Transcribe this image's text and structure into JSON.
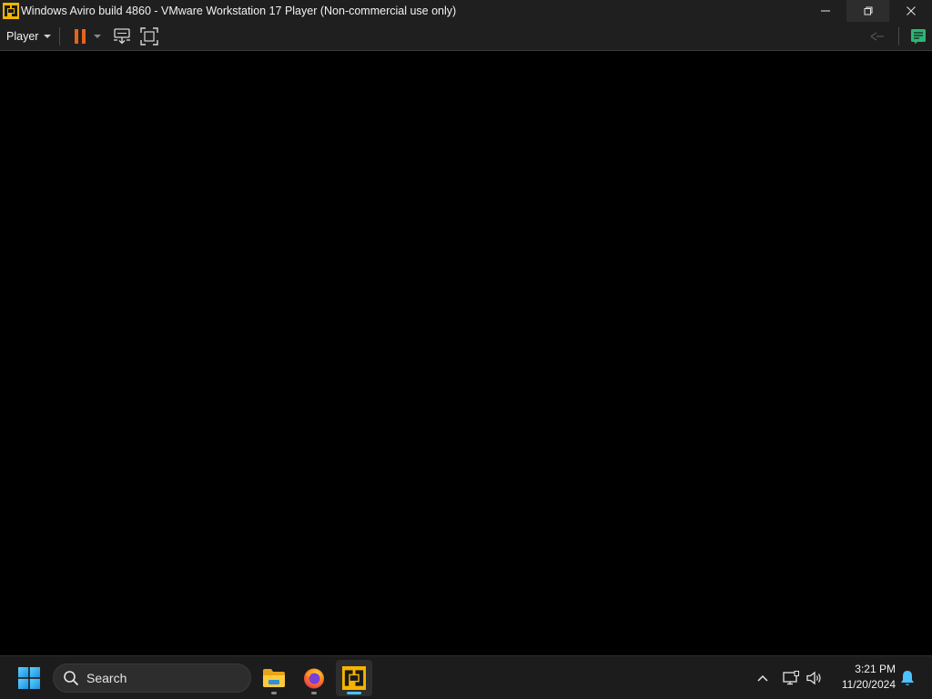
{
  "window": {
    "title": "Windows Aviro build 4860 - VMware Workstation 17 Player (Non-commercial use only)",
    "icon": "vmware-player-icon",
    "controls": [
      "minimize-icon",
      "restore-icon",
      "close-icon"
    ]
  },
  "toolbar": {
    "player_menu_label": "Player",
    "buttons": [
      "pause-icon",
      "send-ctrl-alt-del-icon",
      "full-screen-icon",
      "unity-icon",
      "virtual-machine-notes-icon"
    ],
    "pause_color": "#e8621c",
    "notes_color": "#2bb673"
  },
  "taskbar": {
    "search": {
      "placeholder": "Search"
    },
    "pinned_apps": [
      "file-explorer-icon",
      "firefox-icon",
      "vmware-player-icon"
    ],
    "active_app": "vmware-player-icon",
    "accent": "#4cc2ff",
    "tray": [
      "show-hidden-icons-chevron",
      "network-icon",
      "volume-icon"
    ],
    "clock": {
      "time": "3:21 PM",
      "date": "11/20/2024"
    },
    "notification_icon": "bell-icon"
  }
}
